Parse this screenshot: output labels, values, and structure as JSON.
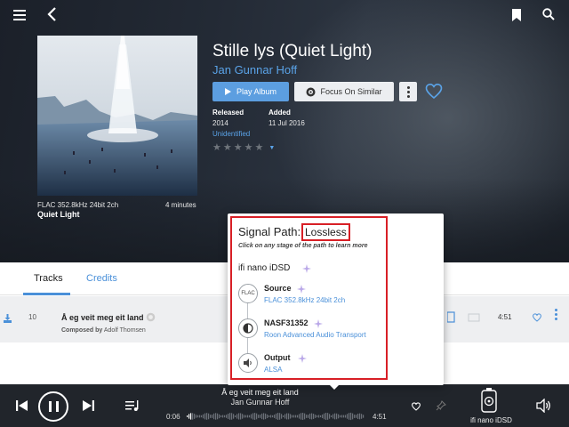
{
  "album": {
    "title": "Stille lys (Quiet Light)",
    "artist": "Jan Gunnar Hoff",
    "play_label": "Play Album",
    "focus_label": "Focus On Similar",
    "released_label": "Released",
    "released_value": "2014",
    "released_extra": "Unidentified",
    "added_label": "Added",
    "added_value": "11 Jul 2016",
    "rating": 0,
    "quality": "FLAC 352.8kHz 24bit 2ch",
    "duration": "4 minutes",
    "cover_caption": "Quiet Light"
  },
  "tabs": [
    "Tracks",
    "Credits"
  ],
  "track": {
    "number": "10",
    "title": "Å eg veit meg eit land",
    "composer_prefix": "Composed by",
    "composer": "Adolf Thomsen",
    "duration": "4:51"
  },
  "signal_path": {
    "title": "Signal Path:",
    "quality": "Lossless",
    "hint": "Click on any stage of the path to learn more",
    "device": "ifi nano iDSD",
    "stages": [
      {
        "icon": "FLAC",
        "name": "Source",
        "detail": "FLAC 352.8kHz 24bit 2ch"
      },
      {
        "icon": "roon-icon",
        "name": "NASF31352",
        "detail": "Roon Advanced Audio Transport"
      },
      {
        "icon": "speaker-icon",
        "name": "Output",
        "detail": "ALSA"
      }
    ]
  },
  "player": {
    "title": "Å eg veit meg eit land",
    "artist": "Jan Gunnar Hoff",
    "elapsed": "0:06",
    "total": "4:51",
    "zone": "ifi nano iDSD"
  },
  "colors": {
    "accent": "#4a90d9",
    "link": "#5aa3e8",
    "highlight": "#d81f26",
    "player_bg": "#21252b"
  }
}
